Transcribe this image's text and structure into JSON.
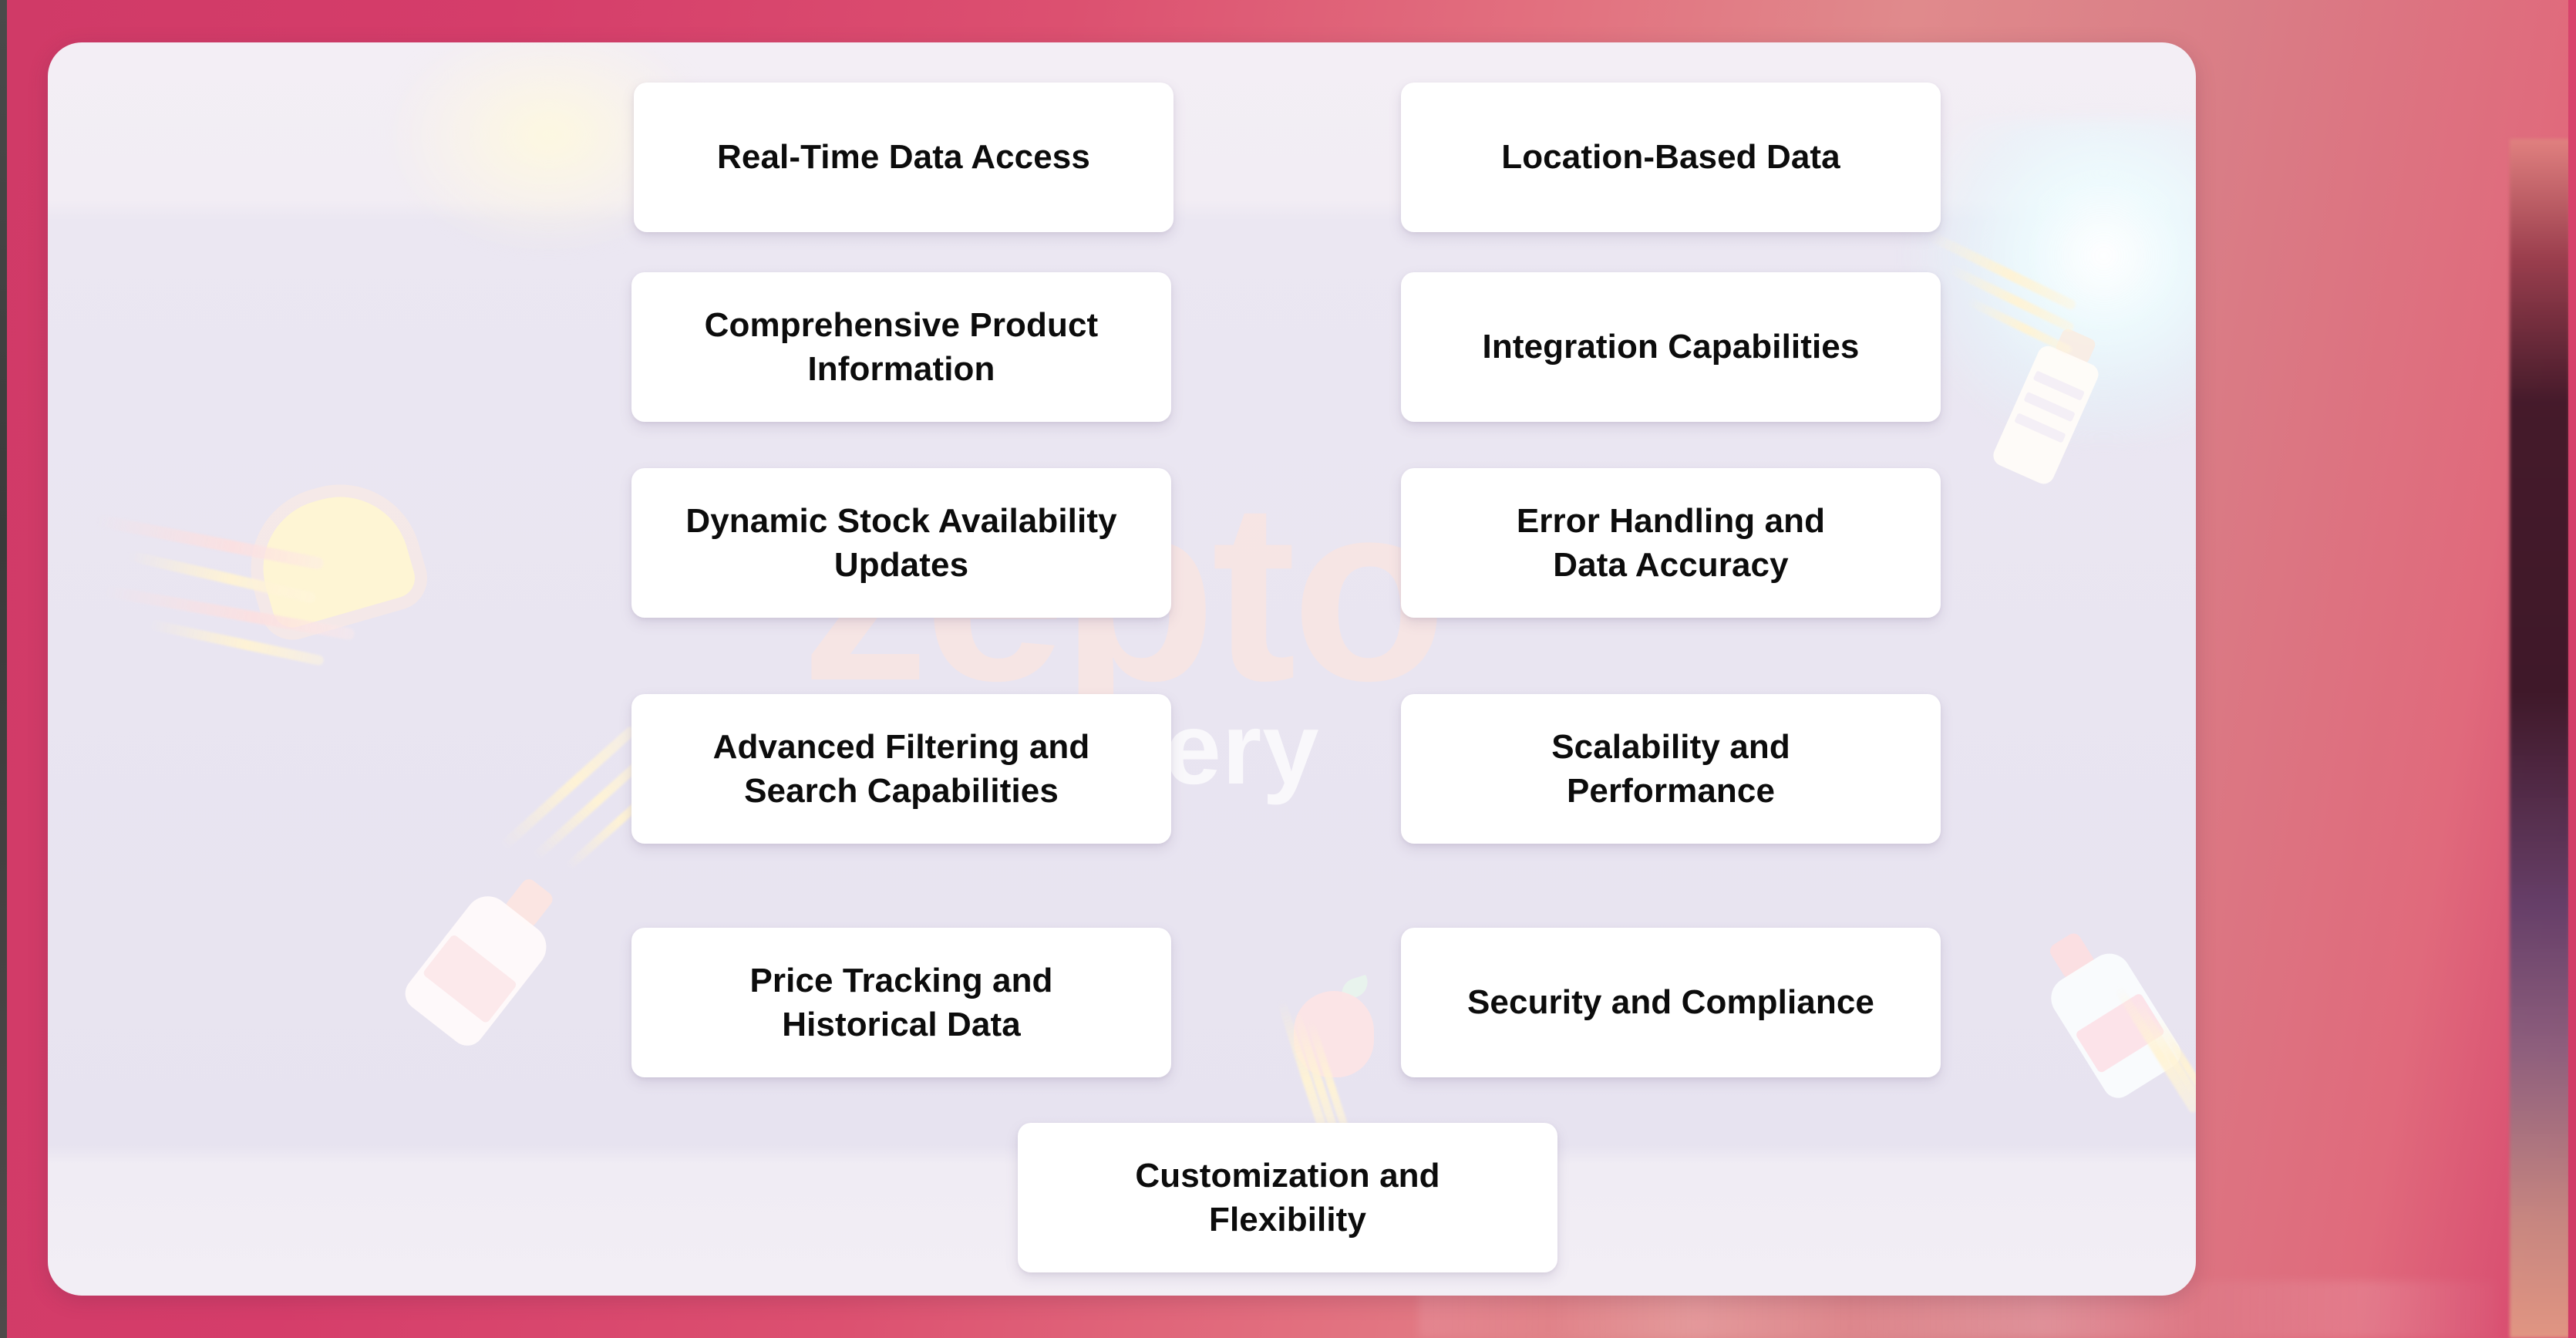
{
  "theme": {
    "frame_color": "#d03a67",
    "panel_background": "#e9e5f1",
    "card_background": "#ffffff",
    "card_text_color": "#0c0c0c",
    "watermark_zepto_color": "#ffe4dc",
    "watermark_grocery_color": "#ffffff"
  },
  "watermark": {
    "brand": "zepto",
    "tagline": "Grocery"
  },
  "cards": [
    {
      "id": "real-time-data-access",
      "label": "Real-Time Data Access",
      "column": "left",
      "row": 1
    },
    {
      "id": "location-based-data",
      "label": "Location-Based Data",
      "column": "right",
      "row": 1
    },
    {
      "id": "comprehensive-product-info",
      "label": "Comprehensive Product\nInformation",
      "column": "left",
      "row": 2
    },
    {
      "id": "integration-capabilities",
      "label": "Integration Capabilities",
      "column": "right",
      "row": 2
    },
    {
      "id": "dynamic-stock-availability",
      "label": "Dynamic Stock Availability\nUpdates",
      "column": "left",
      "row": 3
    },
    {
      "id": "error-handling-data-accuracy",
      "label": "Error Handling and\nData Accuracy",
      "column": "right",
      "row": 3
    },
    {
      "id": "advanced-filtering-search",
      "label": "Advanced Filtering and\nSearch Capabilities",
      "column": "left",
      "row": 4
    },
    {
      "id": "scalability-performance",
      "label": "Scalability and\nPerformance",
      "column": "right",
      "row": 4
    },
    {
      "id": "price-tracking-historical",
      "label": "Price Tracking and\nHistorical Data",
      "column": "left",
      "row": 5
    },
    {
      "id": "security-and-compliance",
      "label": "Security and Compliance",
      "column": "right",
      "row": 5
    },
    {
      "id": "customization-flexibility",
      "label": "Customization and\nFlexibility",
      "column": "center",
      "row": 6
    }
  ],
  "decorations": [
    {
      "name": "bread-slice-illustration",
      "position": "left-upper"
    },
    {
      "name": "bottle-illustration",
      "position": "left-lower"
    },
    {
      "name": "bottle-illustration",
      "position": "right-lower"
    },
    {
      "name": "tube-package-illustration",
      "position": "right-upper"
    },
    {
      "name": "banana-illustration",
      "position": "right-middle"
    },
    {
      "name": "apple-illustration",
      "position": "center-lower"
    }
  ]
}
